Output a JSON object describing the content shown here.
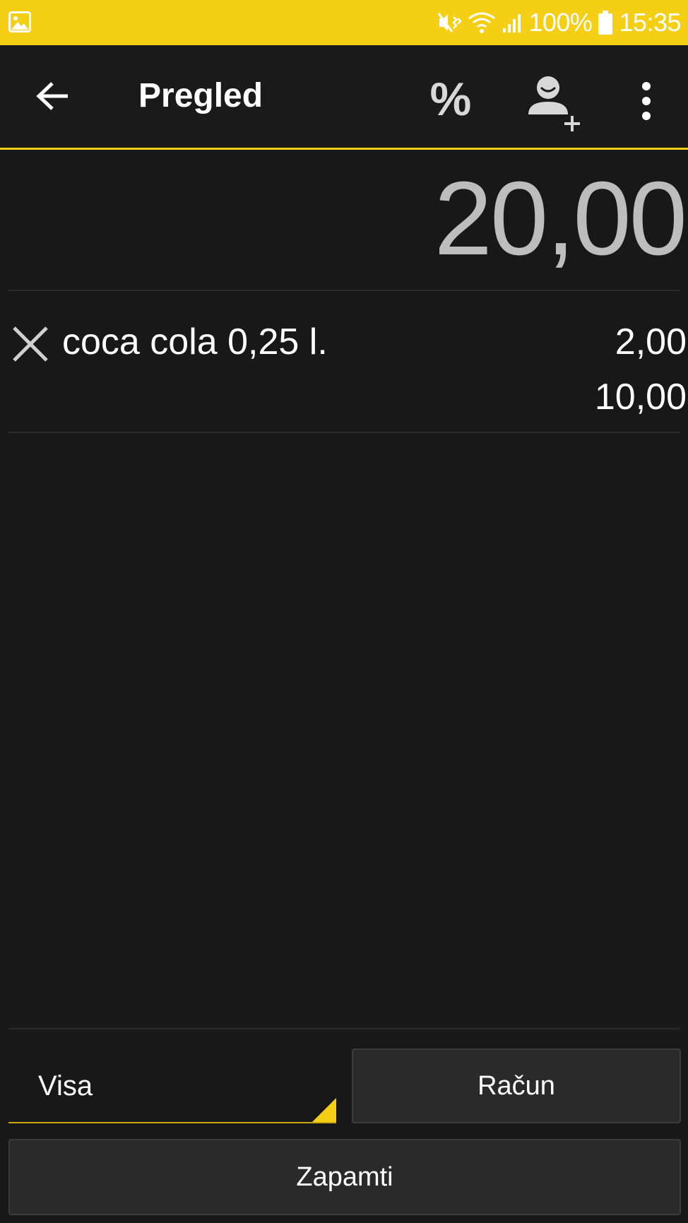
{
  "status_bar": {
    "battery_text": "100%",
    "time": "15:35",
    "background_color": "#f5ce16",
    "icons": [
      "gallery-icon",
      "mute-vibrate-icon",
      "wifi-icon",
      "signal-icon",
      "battery-icon"
    ]
  },
  "app_bar": {
    "title": "Pregled",
    "discount_label": "%",
    "icons": [
      "back-arrow-icon",
      "percent-icon",
      "add-person-icon",
      "more-vert-icon"
    ],
    "accent_color": "#f5ce16"
  },
  "order": {
    "total": "20,00",
    "items": [
      {
        "name": "coca cola 0,25 l.",
        "price": "2,00",
        "total": "10,00"
      }
    ]
  },
  "bottom": {
    "payment_method": "Visa",
    "receipt_label": "Račun",
    "save_label": "Zapamti"
  }
}
